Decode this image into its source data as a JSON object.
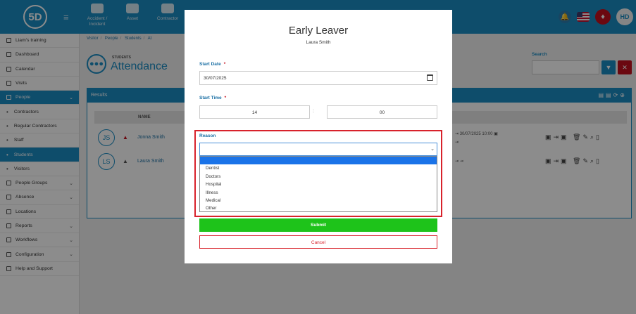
{
  "app": {
    "logo_text": "5D",
    "user_initials": "HD"
  },
  "topnav": [
    {
      "label": "Accident / Incident",
      "icon": "first-aid-icon"
    },
    {
      "label": "Asset",
      "icon": "boxes-icon"
    },
    {
      "label": "Contractor",
      "icon": "hardhat-icon"
    }
  ],
  "sidebar": {
    "items": [
      {
        "label": "Liam's training",
        "type": "top",
        "chevron": ""
      },
      {
        "label": "Dashboard",
        "type": "top",
        "chevron": ""
      },
      {
        "label": "Calendar",
        "type": "top",
        "chevron": ""
      },
      {
        "label": "Visits",
        "type": "top",
        "chevron": ""
      },
      {
        "label": "People",
        "type": "top-active",
        "chevron": "⌄"
      },
      {
        "label": "Contractors",
        "type": "sub",
        "chevron": ""
      },
      {
        "label": "Regular Contractors",
        "type": "sub",
        "chevron": ""
      },
      {
        "label": "Staff",
        "type": "sub",
        "chevron": ""
      },
      {
        "label": "Students",
        "type": "sub-active",
        "chevron": ""
      },
      {
        "label": "Visitors",
        "type": "sub",
        "chevron": ""
      },
      {
        "label": "People Groups",
        "type": "top",
        "chevron": "⌄"
      },
      {
        "label": "Absence",
        "type": "top",
        "chevron": "⌄"
      },
      {
        "label": "Locations",
        "type": "top",
        "chevron": ""
      },
      {
        "label": "Reports",
        "type": "top",
        "chevron": "⌄"
      },
      {
        "label": "Workflows",
        "type": "top",
        "chevron": "⌄"
      },
      {
        "label": "Configuration",
        "type": "top",
        "chevron": "⌄"
      },
      {
        "label": "Help and Support",
        "type": "top",
        "chevron": ""
      }
    ]
  },
  "breadcrumb": [
    "Visitor",
    "People",
    "Students",
    "At"
  ],
  "page": {
    "kicker": "STUDENTS",
    "title": "Attendance"
  },
  "search": {
    "label": "Search",
    "value": ""
  },
  "results": {
    "title": "Results",
    "column_name": "NAME"
  },
  "rows": [
    {
      "initials": "JS",
      "name": "Jonna Smith",
      "time": "30/07/2025 10:00"
    },
    {
      "initials": "LS",
      "name": "Laura Smith",
      "time": ""
    }
  ],
  "modal": {
    "title": "Early Leaver",
    "subtitle": "Laura Smith",
    "start_date_label": "Start Date",
    "start_date_value": "30/07/2025",
    "start_time_label": "Start Time",
    "hour_value": "14",
    "colon": ":",
    "minute_value": "00",
    "reason_label": "Reason",
    "reason_selected": "",
    "required_mark": "*",
    "reason_options": [
      "",
      "Dentist",
      "Doctors",
      "Hospital",
      "Illness",
      "Medical",
      "Other"
    ],
    "submit_label": "Submit",
    "cancel_label": "Cancel"
  },
  "colors": {
    "primary": "#1a8cc4",
    "danger": "#d8222b",
    "success": "#1ec31a"
  }
}
